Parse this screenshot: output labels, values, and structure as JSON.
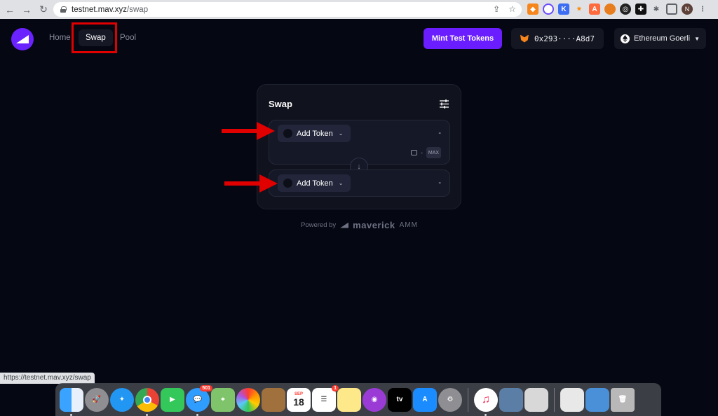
{
  "browser": {
    "url_host": "testnet.mav.xyz",
    "url_path": "/swap",
    "profile_initial": "N"
  },
  "header": {
    "nav": [
      "Home",
      "Swap",
      "Pool"
    ],
    "mint_label": "Mint Test Tokens",
    "wallet_address": "0x293····A8d7",
    "network": "Ethereum Goerli"
  },
  "swap": {
    "title": "Swap",
    "from": {
      "token_label": "Add Token",
      "amount": "-",
      "balance": "-",
      "max_label": "MAX"
    },
    "to": {
      "token_label": "Add Token",
      "amount": "-"
    }
  },
  "footer": {
    "powered_label": "Powered by",
    "brand": "maverick",
    "brand_suffix": "AMM"
  },
  "status_bar": {
    "url": "https://testnet.mav.xyz/swap"
  },
  "dock": {
    "messages_badge": "501",
    "reminders_badge": "1",
    "calendar_month": "SEP",
    "calendar_day": "18",
    "tv_label": "tv"
  },
  "colors": {
    "accent": "#6a1dff",
    "background": "#050712",
    "annotation": "#e00000"
  }
}
